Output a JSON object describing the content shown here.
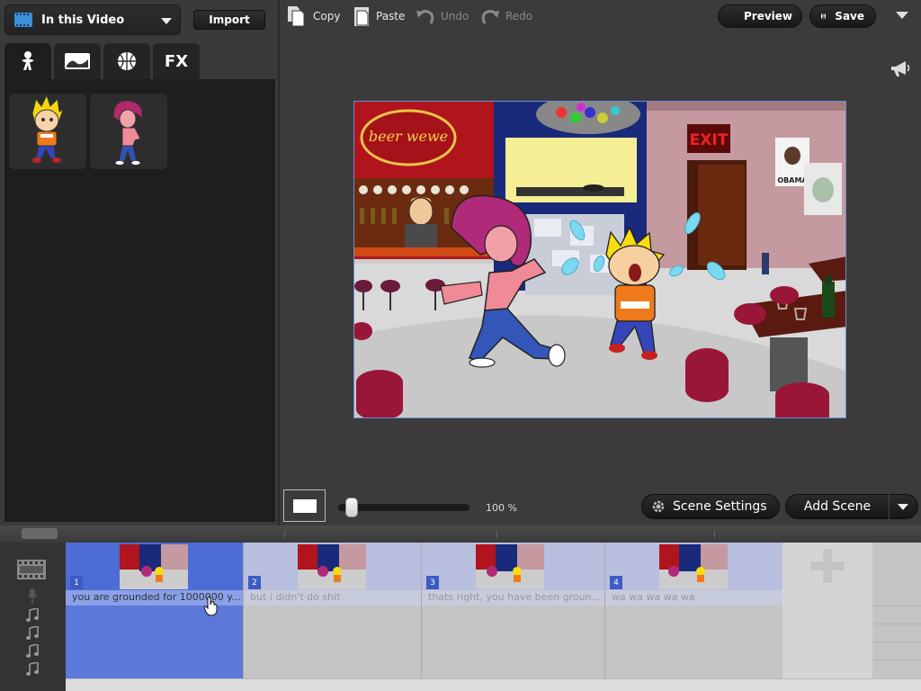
{
  "source": {
    "label": "In this Video",
    "icon": "film-icon"
  },
  "import_label": "Import",
  "category_tabs": [
    {
      "name": "characters",
      "icon": "character-icon"
    },
    {
      "name": "backgrounds",
      "icon": "landscape-icon"
    },
    {
      "name": "props",
      "icon": "basketball-icon"
    },
    {
      "name": "effects",
      "label": "FX"
    }
  ],
  "assets": [
    {
      "name": "blonde-boy"
    },
    {
      "name": "pink-haired-girl"
    }
  ],
  "toolbar": {
    "copy": "Copy",
    "paste": "Paste",
    "undo": "Undo",
    "redo": "Redo",
    "preview": "Preview",
    "save": "Save"
  },
  "stage": {
    "sign_text": "beer wewe",
    "exit_text": "EXIT",
    "poster_text": "OBAMA"
  },
  "zoom": {
    "value": 0.05,
    "label": "100 %"
  },
  "scene_settings_label": "Scene Settings",
  "add_scene_label": "Add Scene",
  "timeline": {
    "scenes": [
      {
        "number": "1",
        "text": "you are grounded for 1000000 y...",
        "selected": true
      },
      {
        "number": "2",
        "text": "but i didn't do shit",
        "selected": false
      },
      {
        "number": "3",
        "text": "thats right, you have been groun...",
        "selected": false
      },
      {
        "number": "4",
        "text": "wa wa wa wa wa",
        "selected": false
      }
    ],
    "track_icons": [
      "film-strip-icon",
      "microphone-icon",
      "music-note-icon",
      "music-note-icon",
      "music-note-icon",
      "music-note-icon"
    ]
  },
  "colors": {
    "accent": "#5c78d8",
    "selected_scene": "#4e6cd6"
  }
}
